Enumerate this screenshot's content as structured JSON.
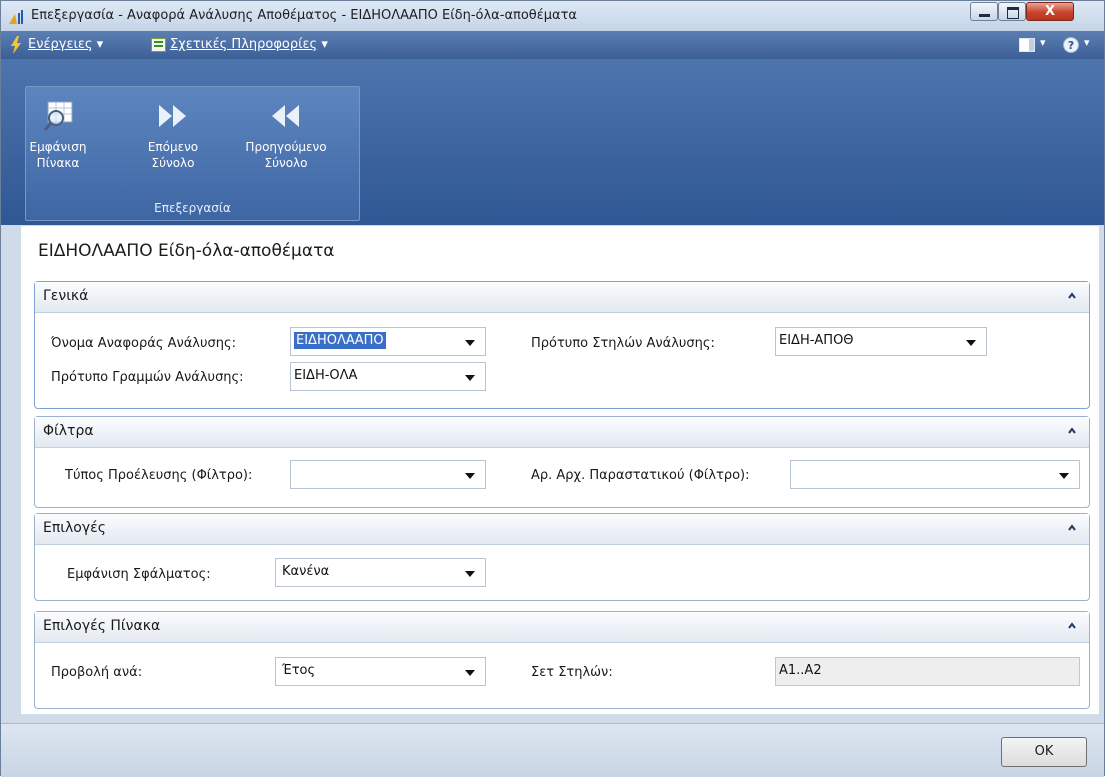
{
  "window": {
    "title": "Επεξεργασία - Αναφορά Ανάλυσης Αποθέματος - ΕΙΔΗΟΛΑΑΠΟ Είδη-όλα-αποθέματα",
    "close_label": "X"
  },
  "menubar": {
    "actions_label": "Ενέργειες",
    "related_info_label": "Σχετικές Πληροφορίες"
  },
  "ribbon": {
    "buttons": [
      {
        "line1": "Εμφάνιση",
        "line2": "Πίνακα"
      },
      {
        "line1": "Επόμενο",
        "line2": "Σύνολο"
      },
      {
        "line1": "Προηγούμενο",
        "line2": "Σύνολο"
      }
    ],
    "group_label": "Επεξεργασία"
  },
  "page": {
    "title": "ΕΙΔΗΟΛΑΑΠΟ Είδη-όλα-αποθέματα"
  },
  "general": {
    "title": "Γενικά",
    "report_name_label": "Όνομα Αναφοράς Ανάλυσης:",
    "report_name_value": "ΕΙΔΗΟΛΑΑΠΟ",
    "line_template_label": "Πρότυπο Γραμμών Ανάλυσης:",
    "line_template_value": "ΕΙΔΗ-ΟΛΑ",
    "column_template_label": "Πρότυπο Στηλών Ανάλυσης:",
    "column_template_value": "ΕΙΔΗ-ΑΠΟΘ"
  },
  "filters": {
    "title": "Φίλτρα",
    "source_type_label": "Τύπος Προέλευσης (Φίλτρο):",
    "source_type_value": "",
    "doc_no_label": "Αρ. Αρχ. Παραστατικού (Φίλτρο):",
    "doc_no_value": ""
  },
  "options": {
    "title": "Επιλογές",
    "show_error_label": "Εμφάνιση Σφάλματος:",
    "show_error_value": "Κανένα"
  },
  "matrix_options": {
    "title": "Επιλογές Πίνακα",
    "view_by_label": "Προβολή ανά:",
    "view_by_value": "Έτος",
    "column_set_label": "Σετ Στηλών:",
    "column_set_value": "A1..A2"
  },
  "footer": {
    "ok_label": "OK"
  }
}
